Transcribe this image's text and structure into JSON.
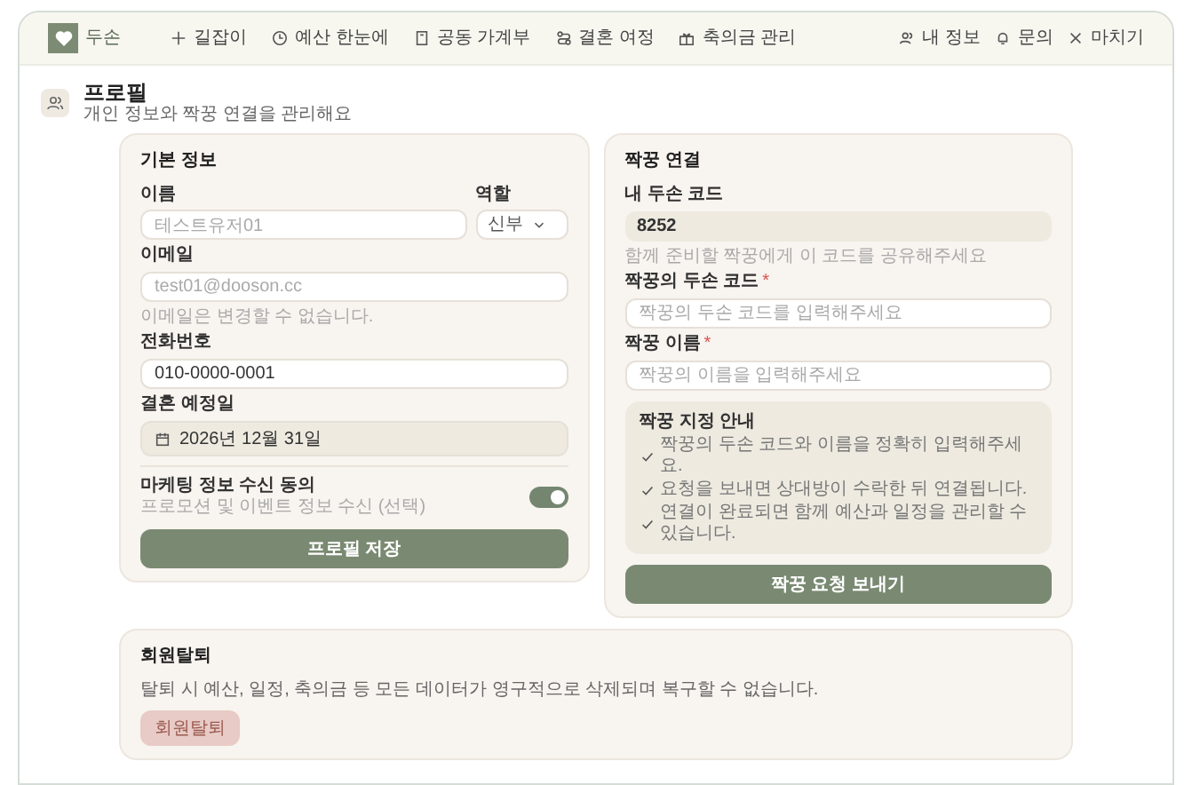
{
  "header": {
    "logo": "두손",
    "nav": [
      {
        "label": "길잡이",
        "selected": false
      },
      {
        "label": "예산 한눈에",
        "selected": false
      },
      {
        "label": "공동 가계부",
        "selected": false
      },
      {
        "label": "결혼 여정",
        "selected": false
      },
      {
        "label": "축의금 관리",
        "selected": false
      }
    ],
    "actions": [
      "내 정보",
      "문의",
      "마치기"
    ]
  },
  "page": {
    "title": "프로필",
    "subtitle": "개인 정보와 짝꿍 연결을 관리해요"
  },
  "basic_info": {
    "title": "기본 정보",
    "name": {
      "label": "이름",
      "value": "테스트유저01",
      "disabled": true
    },
    "role": {
      "label": "역할",
      "value": "신부"
    },
    "email": {
      "label": "이메일",
      "value": "test01@dooson.cc",
      "disabled": true,
      "hint": "이메일은 변경할 수 없습니다."
    },
    "phone": {
      "label": "전화번호",
      "value": "010-0000-0001",
      "disabled": false
    },
    "wedding_date": {
      "label": "결혼 예정일",
      "value": "2026년 12월 31일"
    },
    "marketing": {
      "label": "마케팅 정보 수신 동의",
      "description": "프로모션 및 이벤트 정보 수신 (선택)",
      "on": true
    },
    "save_button": "프로필 저장"
  },
  "partner": {
    "title": "짝꿍 연결",
    "my_code": {
      "label": "내 두손 코드",
      "value": "8252",
      "hint": "함께 준비할 짝꿍에게 이 코드를 공유해주세요"
    },
    "fields": [
      {
        "label": "짝꿍의 두손 코드",
        "required_mark": "*",
        "placeholder": "짝꿍의 두손 코드를 입력해주세요"
      },
      {
        "label": "짝꿍 이름",
        "required_mark": "*",
        "placeholder": "짝꿍의 이름을 입력해주세요"
      }
    ],
    "guide": {
      "title": "짝꿍 지정 안내",
      "items": [
        "짝꿍의 두손 코드와 이름을 정확히 입력해주세요.",
        "요청을 보내면 상대방이 수락한 뒤 연결됩니다.",
        "연결이 완료되면 함께 예산과 일정을 관리할 수 있습니다."
      ]
    },
    "send_button": "짝꿍 요청 보내기"
  },
  "withdraw": {
    "title": "회원탈퇴",
    "text": "탈퇴 시 예산, 일정, 축의금 등 모든 데이터가 영구적으로 삭제되며 복구할 수 없습니다.",
    "button": "회원탈퇴"
  }
}
